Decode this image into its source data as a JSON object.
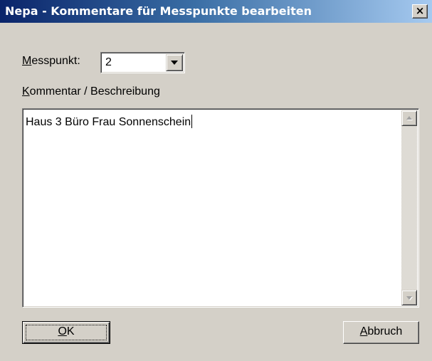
{
  "window": {
    "title": "Nepa - Kommentare für Messpunkte bearbeiten",
    "close_glyph": "×"
  },
  "messpunkt": {
    "label_mnemonic": "M",
    "label_rest": "esspunkt:",
    "selected_value": "2"
  },
  "kommentar": {
    "label_mnemonic": "K",
    "label_rest": "ommentar / Beschreibung",
    "text": "Haus 3 Büro Frau Sonnenschein"
  },
  "buttons": {
    "ok_mnemonic": "O",
    "ok_rest": "K",
    "cancel_mnemonic": "A",
    "cancel_rest": "bbruch"
  },
  "icons": {
    "close": "close-icon",
    "dropdown": "chevron-down-icon",
    "scroll_up": "scroll-up-arrow-icon",
    "scroll_down": "scroll-down-arrow-icon"
  },
  "colors": {
    "titlebar_start": "#0a246a",
    "titlebar_end": "#a6caf0",
    "dialog_face": "#d4d0c8"
  }
}
